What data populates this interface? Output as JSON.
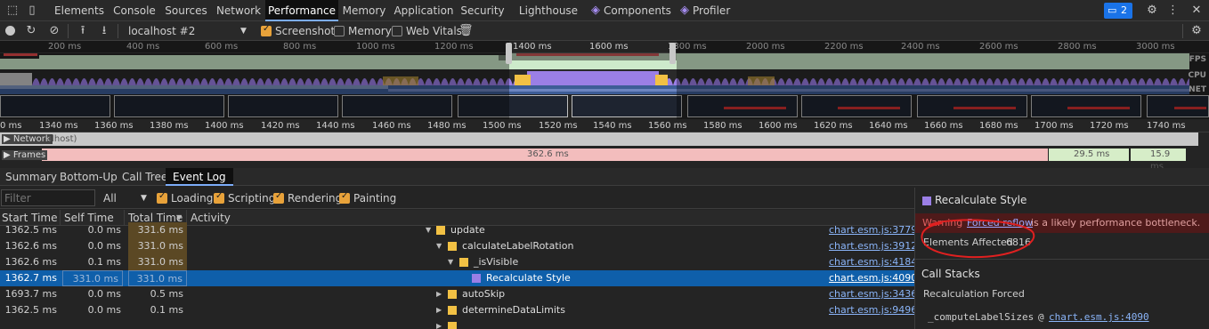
{
  "tabs": [
    "Elements",
    "Console",
    "Sources",
    "Network",
    "Performance",
    "Memory",
    "Application",
    "Security",
    "Lighthouse",
    "Components",
    "Profiler"
  ],
  "issues_count": "2",
  "toolbar": {
    "target": "localhost #2",
    "screenshots": "Screenshots",
    "memory": "Memory",
    "web_vitals": "Web Vitals"
  },
  "overview_ticks": [
    "200 ms",
    "400 ms",
    "600 ms",
    "800 ms",
    "1000 ms",
    "1200 ms",
    "1400 ms",
    "1600 ms",
    "1800 ms",
    "2000 ms",
    "2200 ms",
    "2400 ms",
    "2600 ms",
    "2800 ms",
    "3000 ms"
  ],
  "lane_labels": {
    "fps": "FPS",
    "cpu": "CPU",
    "net": "NET"
  },
  "detail_ticks": [
    "0 ms",
    "1340 ms",
    "1360 ms",
    "1380 ms",
    "1400 ms",
    "1420 ms",
    "1440 ms",
    "1460 ms",
    "1480 ms",
    "1500 ms",
    "1520 ms",
    "1540 ms",
    "1560 ms",
    "1580 ms",
    "1600 ms",
    "1620 ms",
    "1640 ms",
    "1660 ms",
    "1680 ms",
    "1700 ms",
    "1720 ms",
    "1740 ms"
  ],
  "tracks": {
    "network": "Network",
    "network_suffix": "alhost)",
    "frames": "Frames",
    "frame1": "362.6 ms",
    "frame2": "29.5 ms",
    "frame3": "15.9 ms"
  },
  "lower_tabs": [
    "Summary",
    "Bottom-Up",
    "Call Tree",
    "Event Log"
  ],
  "filter": {
    "placeholder": "Filter",
    "select": "All",
    "categories": [
      "Loading",
      "Scripting",
      "Rendering",
      "Painting"
    ]
  },
  "columns": {
    "start": "Start Time",
    "self": "Self Time",
    "total": "Total Time",
    "activity": "Activity"
  },
  "rows": [
    {
      "start": "1362.5 ms",
      "self": "0.0 ms",
      "total": "331.6 ms",
      "activity": "update",
      "link": "chart.esm.js:3779"
    },
    {
      "start": "1362.6 ms",
      "self": "0.0 ms",
      "total": "331.0 ms",
      "activity": "calculateLabelRotation",
      "link": "chart.esm.js:3912"
    },
    {
      "start": "1362.6 ms",
      "self": "0.1 ms",
      "total": "331.0 ms",
      "activity": "_isVisible",
      "link": "chart.esm.js:4184"
    },
    {
      "start": "1362.7 ms",
      "self": "331.0 ms",
      "total": "331.0 ms",
      "activity": "Recalculate Style",
      "link": "chart.esm.js:4090"
    },
    {
      "start": "1693.7 ms",
      "self": "0.0 ms",
      "total": "0.5 ms",
      "activity": "autoSkip",
      "link": "chart.esm.js:3436"
    },
    {
      "start": "1362.5 ms",
      "self": "0.0 ms",
      "total": "0.1 ms",
      "activity": "determineDataLimits",
      "link": "chart.esm.js:9496"
    }
  ],
  "details": {
    "title": "Recalculate Style",
    "warning_label": "Warning",
    "warning_link": "Forced reflow",
    "warning_text": " is a likely performance bottleneck.",
    "elements_label": "Elements Affected",
    "elements_value": "6816",
    "callstacks": "Call Stacks",
    "recalc_forced": "Recalculation Forced",
    "fn": "_computeLabelSizes",
    "fn_at": "@",
    "fn_link": "chart.esm.js:4090"
  },
  "colors": {
    "accent": "#7cacf8",
    "scripting": "#f2c144",
    "rendering": "#9b7fe6",
    "selected_row": "#0f5faa",
    "warning_bg": "#4e1a1a",
    "annotation": "#e02020"
  }
}
